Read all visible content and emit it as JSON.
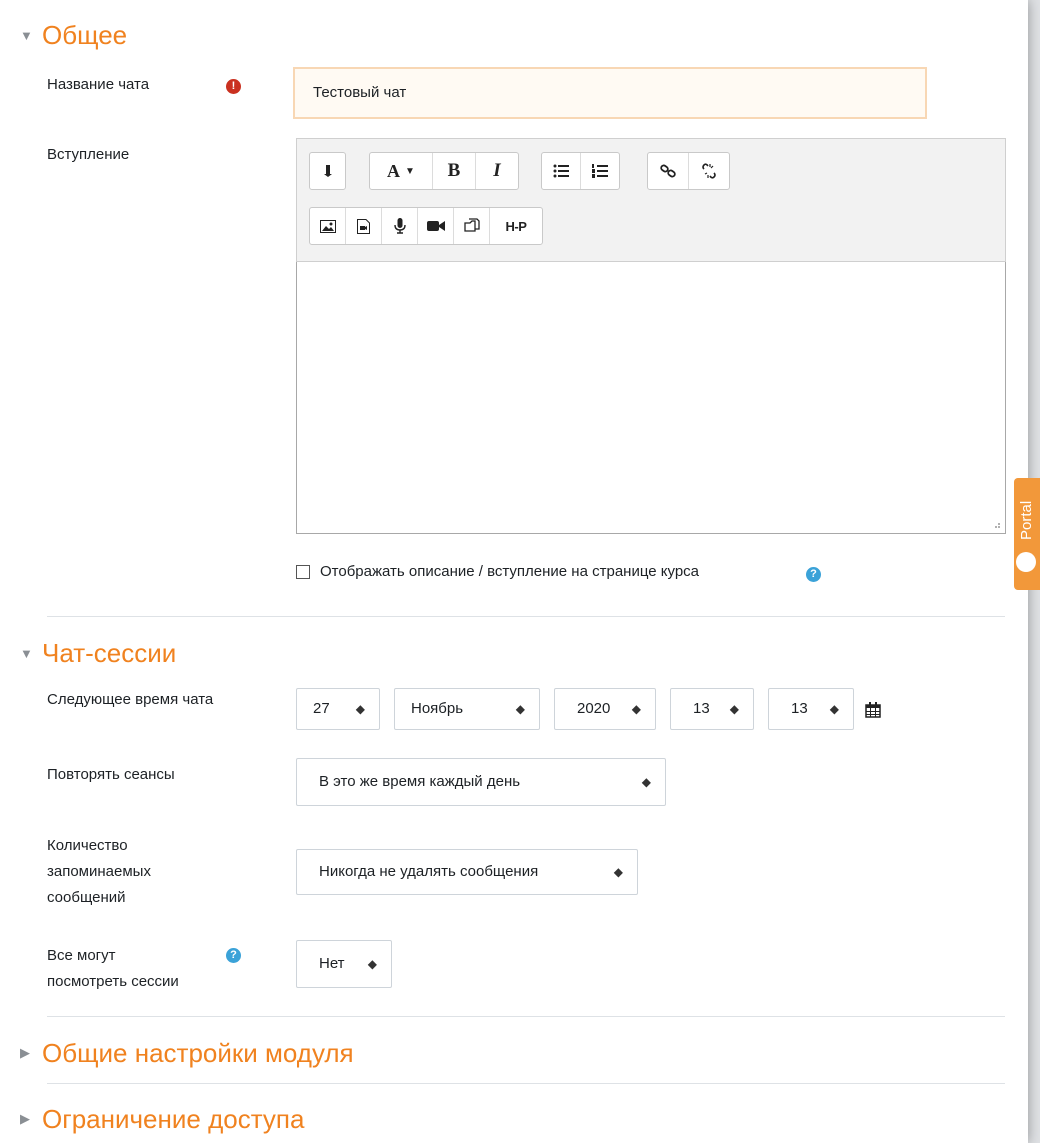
{
  "sections": {
    "general": {
      "title": "Общее",
      "expanded": true
    },
    "sessions": {
      "title": "Чат-сессии",
      "expanded": true
    },
    "module_settings": {
      "title": "Общие настройки модуля",
      "expanded": false
    },
    "access": {
      "title": "Ограничение доступа",
      "expanded": false
    }
  },
  "chat_name": {
    "label": "Название чата",
    "value": "Тестовый чат"
  },
  "intro": {
    "label": "Вступление"
  },
  "editor": {
    "row1": [
      "expand-toolbar-icon",
      "font-size-icon",
      "bold-icon",
      "italic-icon",
      "bullet-list-icon",
      "numbered-list-icon",
      "link-icon",
      "unlink-icon"
    ],
    "row2": [
      "image-icon",
      "media-icon",
      "record-audio-icon",
      "record-video-icon",
      "manage-files-icon",
      "h5p-icon"
    ],
    "bold_glyph": "B",
    "italic_glyph": "I",
    "font_glyph": "A",
    "h5p_glyph": "H-P"
  },
  "show_description": {
    "label": "Отображать описание / вступление на странице курса",
    "checked": false
  },
  "next_chat": {
    "label": "Следующее время чата",
    "day": "27",
    "month": "Ноябрь",
    "year": "2020",
    "hour": "13",
    "minute": "13"
  },
  "repeat": {
    "label": "Повторять сеансы",
    "value": "В это же время каждый день"
  },
  "keep_messages": {
    "label_line1": "Количество",
    "label_line2": "запоминаемых",
    "label_line3": "сообщений",
    "value": "Никогда не удалять сообщения"
  },
  "everyone_sees": {
    "label_line1": "Все могут",
    "label_line2": "посмотреть сессии",
    "value": "Нет"
  },
  "side_tab": {
    "label": "Portal"
  },
  "colors": {
    "accent": "#f0821f",
    "required": "#ca3120",
    "help": "#3ba2d8"
  }
}
